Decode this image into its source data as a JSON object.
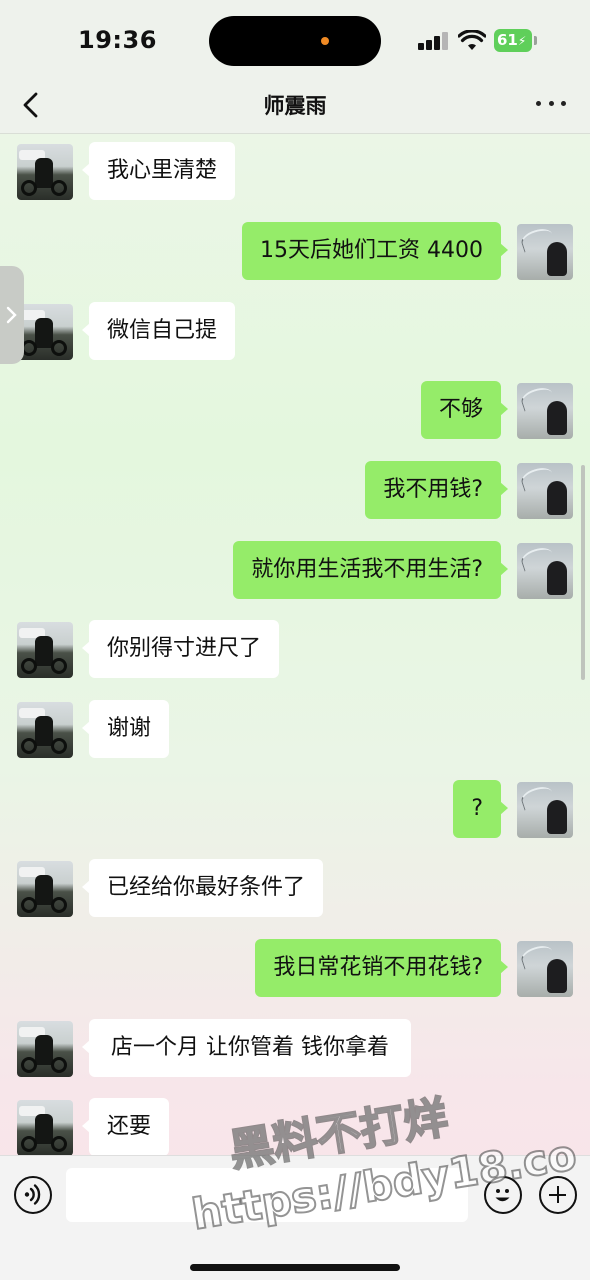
{
  "status_bar": {
    "time": "19:36",
    "battery": "61"
  },
  "header": {
    "title": "师震雨"
  },
  "messages": [
    {
      "side": "left",
      "text": "我心里清楚"
    },
    {
      "side": "right",
      "text": "15天后她们工资 4400"
    },
    {
      "side": "left",
      "text": "微信自己提"
    },
    {
      "side": "right",
      "text": "不够"
    },
    {
      "side": "right",
      "text": "我不用钱?"
    },
    {
      "side": "right",
      "text": "就你用生活我不用生活?"
    },
    {
      "side": "left",
      "text": "你别得寸进尺了"
    },
    {
      "side": "left",
      "text": "谢谢"
    },
    {
      "side": "right",
      "text": "?"
    },
    {
      "side": "left",
      "text": "已经给你最好条件了"
    },
    {
      "side": "right",
      "text": "我日常花销不用花钱?"
    },
    {
      "side": "left",
      "text": "店一个月 让你管着 钱你拿着"
    },
    {
      "side": "left",
      "text": "还要"
    }
  ],
  "input_bar": {
    "value": ""
  },
  "watermark": {
    "line1": "黑料不打烊",
    "line2": "https://bdy18.co"
  },
  "colors": {
    "self_bubble": "#95ec69",
    "other_bubble": "#ffffff"
  }
}
